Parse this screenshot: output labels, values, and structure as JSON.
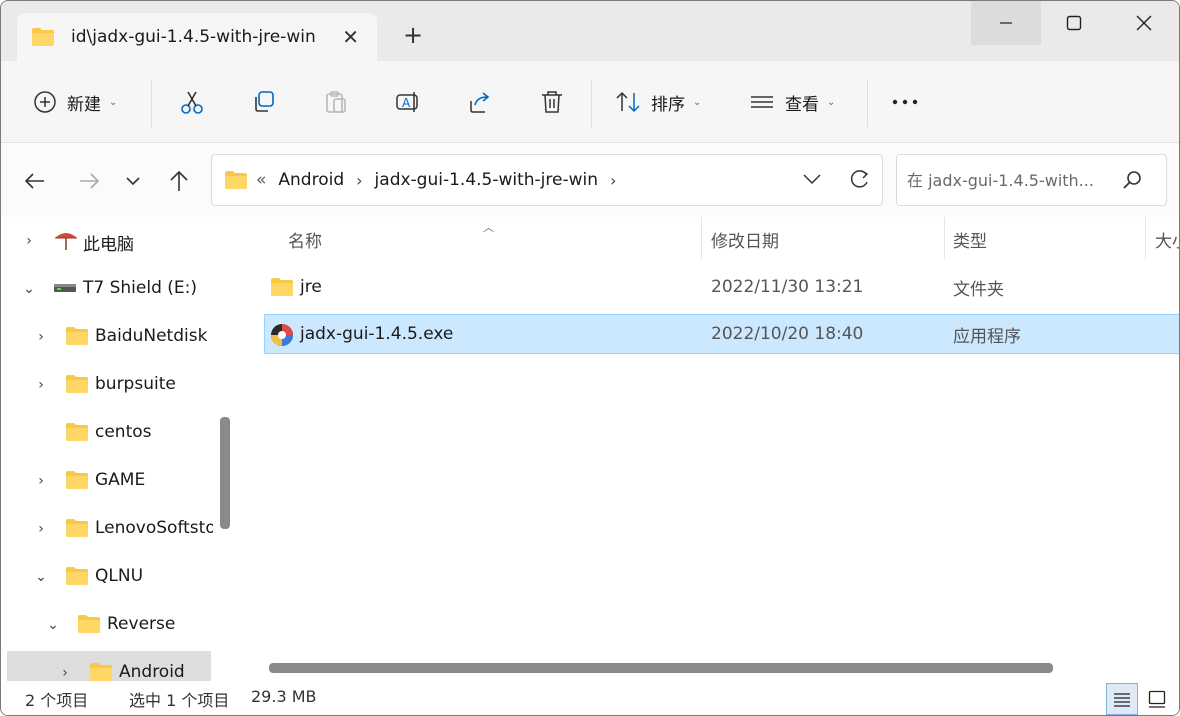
{
  "tab": {
    "title": "id\\jadx-gui-1.4.5-with-jre-win",
    "close_icon": "close-icon",
    "new_tab_icon": "plus-icon"
  },
  "window_controls": [
    "minimize-icon",
    "maximize-icon",
    "close-icon"
  ],
  "toolbar": {
    "new_label": "新建",
    "sort_label": "排序",
    "view_label": "查看",
    "icons": [
      "cut-icon",
      "copy-icon",
      "paste-icon",
      "rename-icon",
      "share-icon",
      "delete-icon",
      "more-icon"
    ]
  },
  "address": {
    "overflow": "«",
    "crumbs": [
      "Android",
      "jadx-gui-1.4.5-with-jre-win"
    ],
    "search_placeholder": "在 jadx-gui-1.4.5-with..."
  },
  "sidebar": {
    "items": [
      {
        "label": "此电脑",
        "icon": "computer-icon"
      },
      {
        "label": "T7 Shield (E:)",
        "icon": "drive-icon"
      },
      {
        "label": "BaiduNetdisk",
        "icon": "folder-icon"
      },
      {
        "label": "burpsuite",
        "icon": "folder-icon"
      },
      {
        "label": "centos",
        "icon": "folder-icon"
      },
      {
        "label": "GAME",
        "icon": "folder-icon"
      },
      {
        "label": "LenovoSoftstore",
        "icon": "folder-icon"
      },
      {
        "label": "QLNU",
        "icon": "folder-icon"
      },
      {
        "label": "Reverse",
        "icon": "folder-icon"
      },
      {
        "label": "Android",
        "icon": "folder-icon"
      }
    ]
  },
  "columns": {
    "name": "名称",
    "modified": "修改日期",
    "type": "类型",
    "size": "大小"
  },
  "files": [
    {
      "name": "jre",
      "modified": "2022/11/30 13:21",
      "type": "文件夹",
      "icon": "folder-icon"
    },
    {
      "name": "jadx-gui-1.4.5.exe",
      "modified": "2022/10/20 18:40",
      "type": "应用程序",
      "icon": "jadx-app-icon",
      "selected": true
    }
  ],
  "status": {
    "count": "2 个项目",
    "selection": "选中 1 个项目",
    "size": "29.3 MB"
  },
  "colors": {
    "accent": "#0067c0",
    "selection_bg": "#cce8ff",
    "folder": "#f8c84a"
  }
}
